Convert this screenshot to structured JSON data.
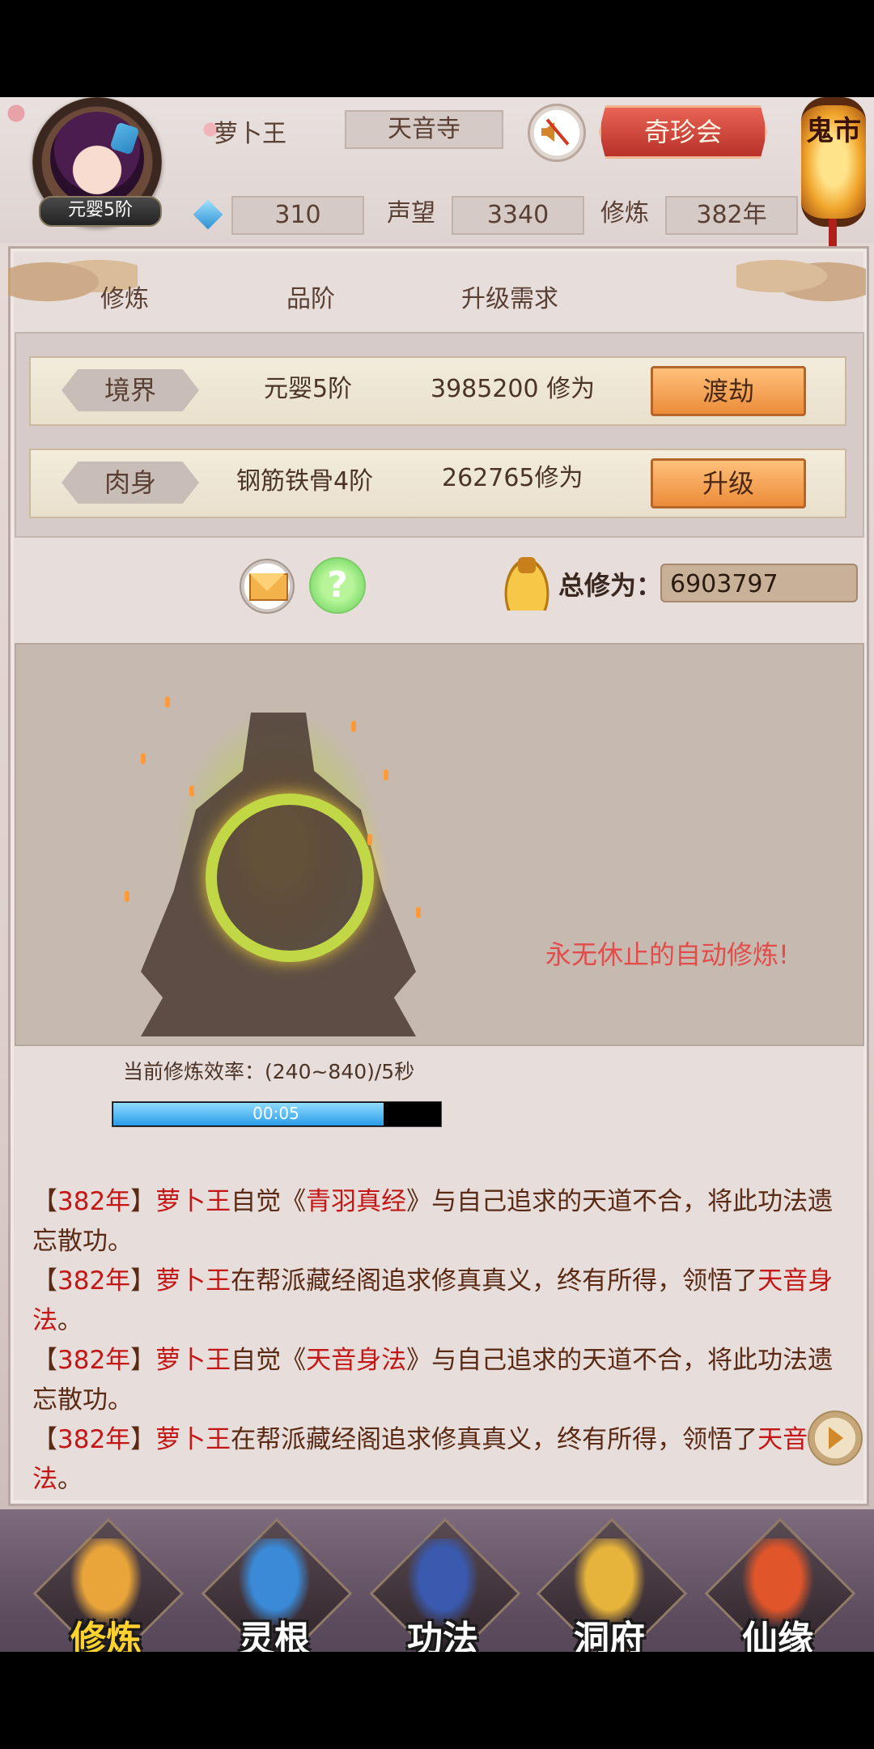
{
  "header": {
    "player_name": "萝卜王",
    "sect": "天音寺",
    "rank_badge": "元婴5阶",
    "treasure_button": "奇珍会",
    "ghost_market": "鬼市",
    "gems": "310",
    "reputation_label": "声望",
    "reputation": "3340",
    "cultivation_label": "修炼",
    "cultivation_years": "382年"
  },
  "columns": {
    "col1": "修炼",
    "col2": "品阶",
    "col3": "升级需求"
  },
  "rows": [
    {
      "tag": "境界",
      "grade": "元婴5阶",
      "requirement": "3985200 修为",
      "button": "渡劫"
    },
    {
      "tag": "肉身",
      "grade": "钢筋铁骨4阶",
      "requirement": "262765修为",
      "button": "升级"
    }
  ],
  "total": {
    "label": "总修为：",
    "value": "6903797"
  },
  "meditation": {
    "efficiency": "当前修炼效率：(240~840)/5秒",
    "timer": "00:05",
    "timer_progress": 0.83,
    "auto_text": "永无休止的自动修炼!"
  },
  "log": [
    {
      "p1": "【",
      "year": "382年",
      "p2": "】",
      "name": "萝卜王",
      "text1": "自觉《",
      "item": "青羽真经",
      "text2": "》与自己追求的天道不合，将此功法遗忘散功。"
    },
    {
      "p1": "【",
      "year": "382年",
      "p2": "】",
      "name": "萝卜王",
      "text1": "在帮派藏经阁追求修真真义，终有所得，领悟了",
      "item": "天音身法",
      "text2": "。"
    },
    {
      "p1": "【",
      "year": "382年",
      "p2": "】",
      "name": "萝卜王",
      "text1": "自觉《",
      "item": "天音身法",
      "text2": "》与自己追求的天道不合，将此功法遗忘散功。"
    },
    {
      "p1": "【",
      "year": "382年",
      "p2": "】",
      "name": "萝卜王",
      "text1": "在帮派藏经阁追求修真真义，终有所得，领悟了",
      "item": "天音心法",
      "text2": "。"
    }
  ],
  "nav": [
    {
      "label": "修炼",
      "icon": "monk-icon",
      "color": "#e9a53a"
    },
    {
      "label": "灵根",
      "icon": "sword-icon",
      "color": "#3a8ad8"
    },
    {
      "label": "功法",
      "icon": "book-icon",
      "color": "#3a5ab0"
    },
    {
      "label": "洞府",
      "icon": "pavilion-icon",
      "color": "#e6b43a"
    },
    {
      "label": "仙缘",
      "icon": "gourd-icon",
      "color": "#e0562a"
    }
  ]
}
